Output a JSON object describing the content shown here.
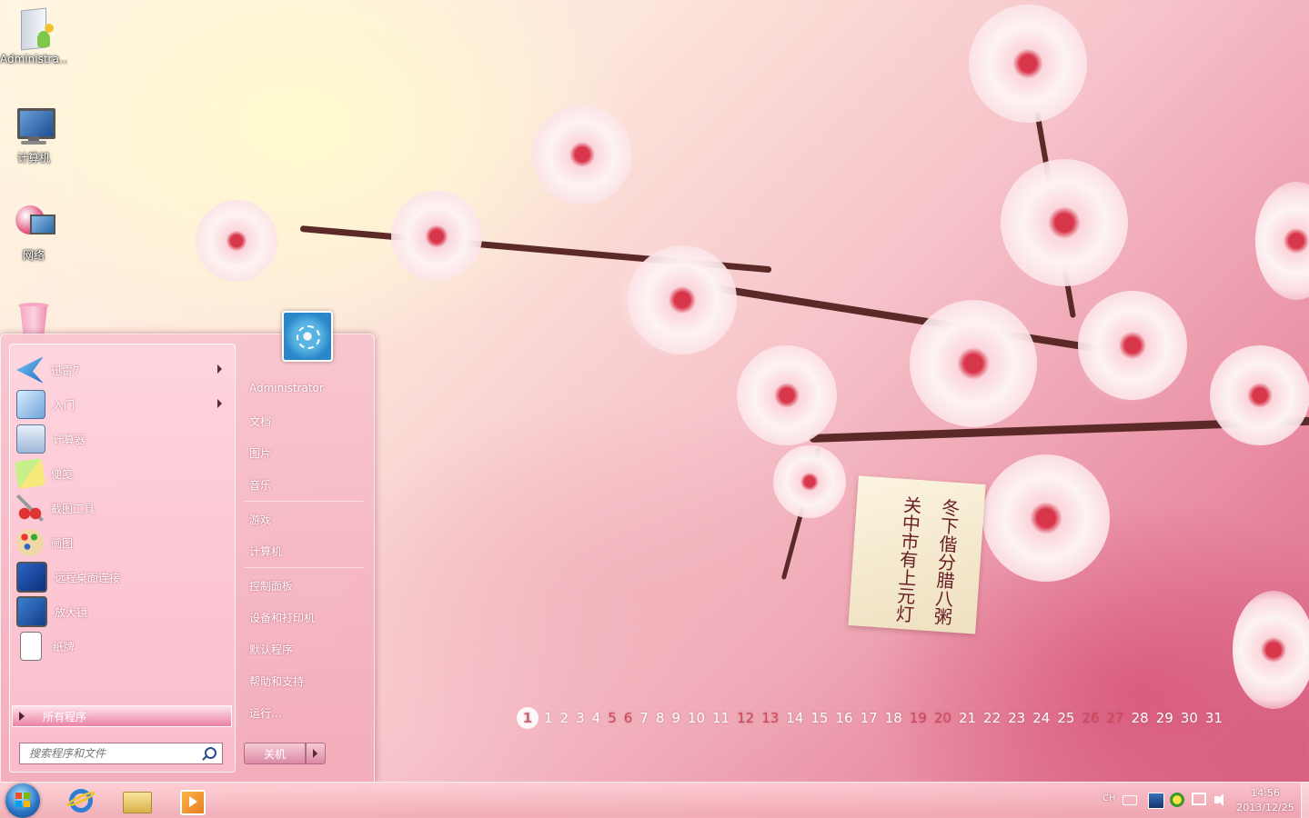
{
  "desktop": {
    "icons": [
      {
        "label": "Administra..."
      },
      {
        "label": "计算机"
      },
      {
        "label": "网络"
      }
    ],
    "wallpaper_tag": {
      "col1": "冬下偕分腊八粥",
      "col2": "关中市有上元灯"
    }
  },
  "start_menu": {
    "programs": [
      {
        "label": "迅雷7"
      },
      {
        "label": "入门"
      },
      {
        "label": "计算器"
      },
      {
        "label": "便笺"
      },
      {
        "label": "截图工具"
      },
      {
        "label": "画图"
      },
      {
        "label": "远程桌面连接"
      },
      {
        "label": "放大镜"
      },
      {
        "label": "纸牌"
      }
    ],
    "all_programs": "所有程序",
    "search_placeholder": "搜索程序和文件",
    "right_items": [
      {
        "label": "Administrator"
      },
      {
        "label": "文档"
      },
      {
        "label": "图片"
      },
      {
        "label": "音乐"
      },
      {
        "label": "游戏"
      },
      {
        "label": "计算机"
      },
      {
        "label": "控制面板"
      },
      {
        "label": "设备和打印机"
      },
      {
        "label": "默认程序"
      },
      {
        "label": "帮助和支持"
      },
      {
        "label": "运行..."
      }
    ],
    "shutdown_label": "关机"
  },
  "calendar": {
    "days": [
      "1",
      "1",
      "2",
      "3",
      "4",
      "5",
      "6",
      "7",
      "8",
      "9",
      "10",
      "11",
      "12",
      "13",
      "14",
      "15",
      "16",
      "17",
      "18",
      "19",
      "20",
      "21",
      "22",
      "23",
      "24",
      "25",
      "26",
      "27",
      "28",
      "29",
      "30",
      "31"
    ],
    "weekend_color": "#d0465c"
  },
  "taskbar": {
    "language": "CH",
    "time": "14:56",
    "date": "2013/12/25"
  }
}
